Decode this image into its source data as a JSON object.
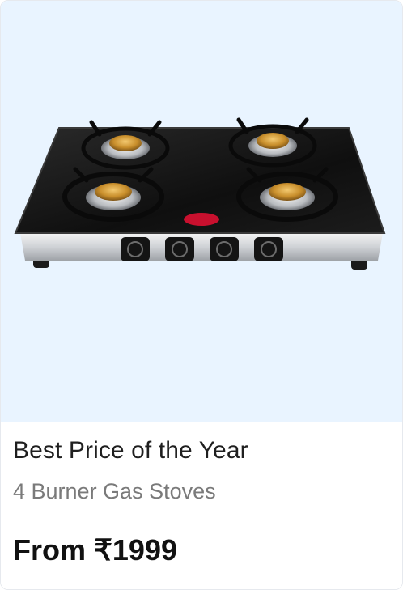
{
  "card": {
    "image_icon": "gas-stove-image",
    "title": "Best Price of the Year",
    "subtitle": "4 Burner Gas Stoves",
    "price": "From ₹1999"
  },
  "colors": {
    "image_background": "#e9f4ff",
    "card_background": "#ffffff",
    "title": "#1f1f1f",
    "subtitle": "#7a7a7a",
    "price": "#111111"
  }
}
